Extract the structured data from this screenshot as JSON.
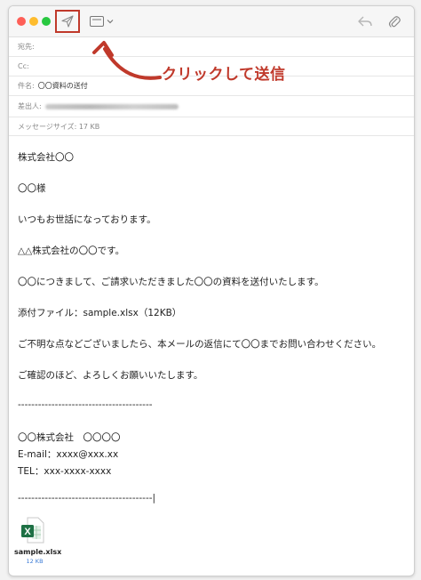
{
  "toolbar": {
    "buttons": [
      "send-icon",
      "compose-format-icon",
      "reply-icon",
      "paperclip-icon"
    ]
  },
  "annotation": {
    "text": "クリックして送信",
    "color": "#c0392b"
  },
  "headers": {
    "to_label": "宛先:",
    "cc_label": "Cc:",
    "subject_label": "件名:",
    "subject_value": "〇〇資料の送付",
    "from_label": "差出人:",
    "size_label": "メッセージサイズ: 17 KB"
  },
  "body": {
    "lines": [
      "株式会社〇〇",
      "〇〇様",
      "いつもお世話になっております。",
      "△△株式会社の〇〇です。",
      "〇〇につきまして、ご請求いただきました〇〇の資料を送付いたします。",
      "添付ファイル：sample.xlsx（12KB）",
      "ご不明な点などございましたら、本メールの返信にて〇〇までお問い合わせください。",
      "ご確認のほど、よろしくお願いいたします。",
      "----------------------------------------",
      "〇〇株式会社　〇〇〇〇",
      "E-mail：xxxx@xxx.xx",
      "TEL：xxx-xxxx-xxxx",
      "----------------------------------------|"
    ]
  },
  "attachment": {
    "icon": "excel-file-icon",
    "icon_letter": "X",
    "filename": "sample.xlsx",
    "size": "12 KB",
    "color": "#1d7044"
  }
}
